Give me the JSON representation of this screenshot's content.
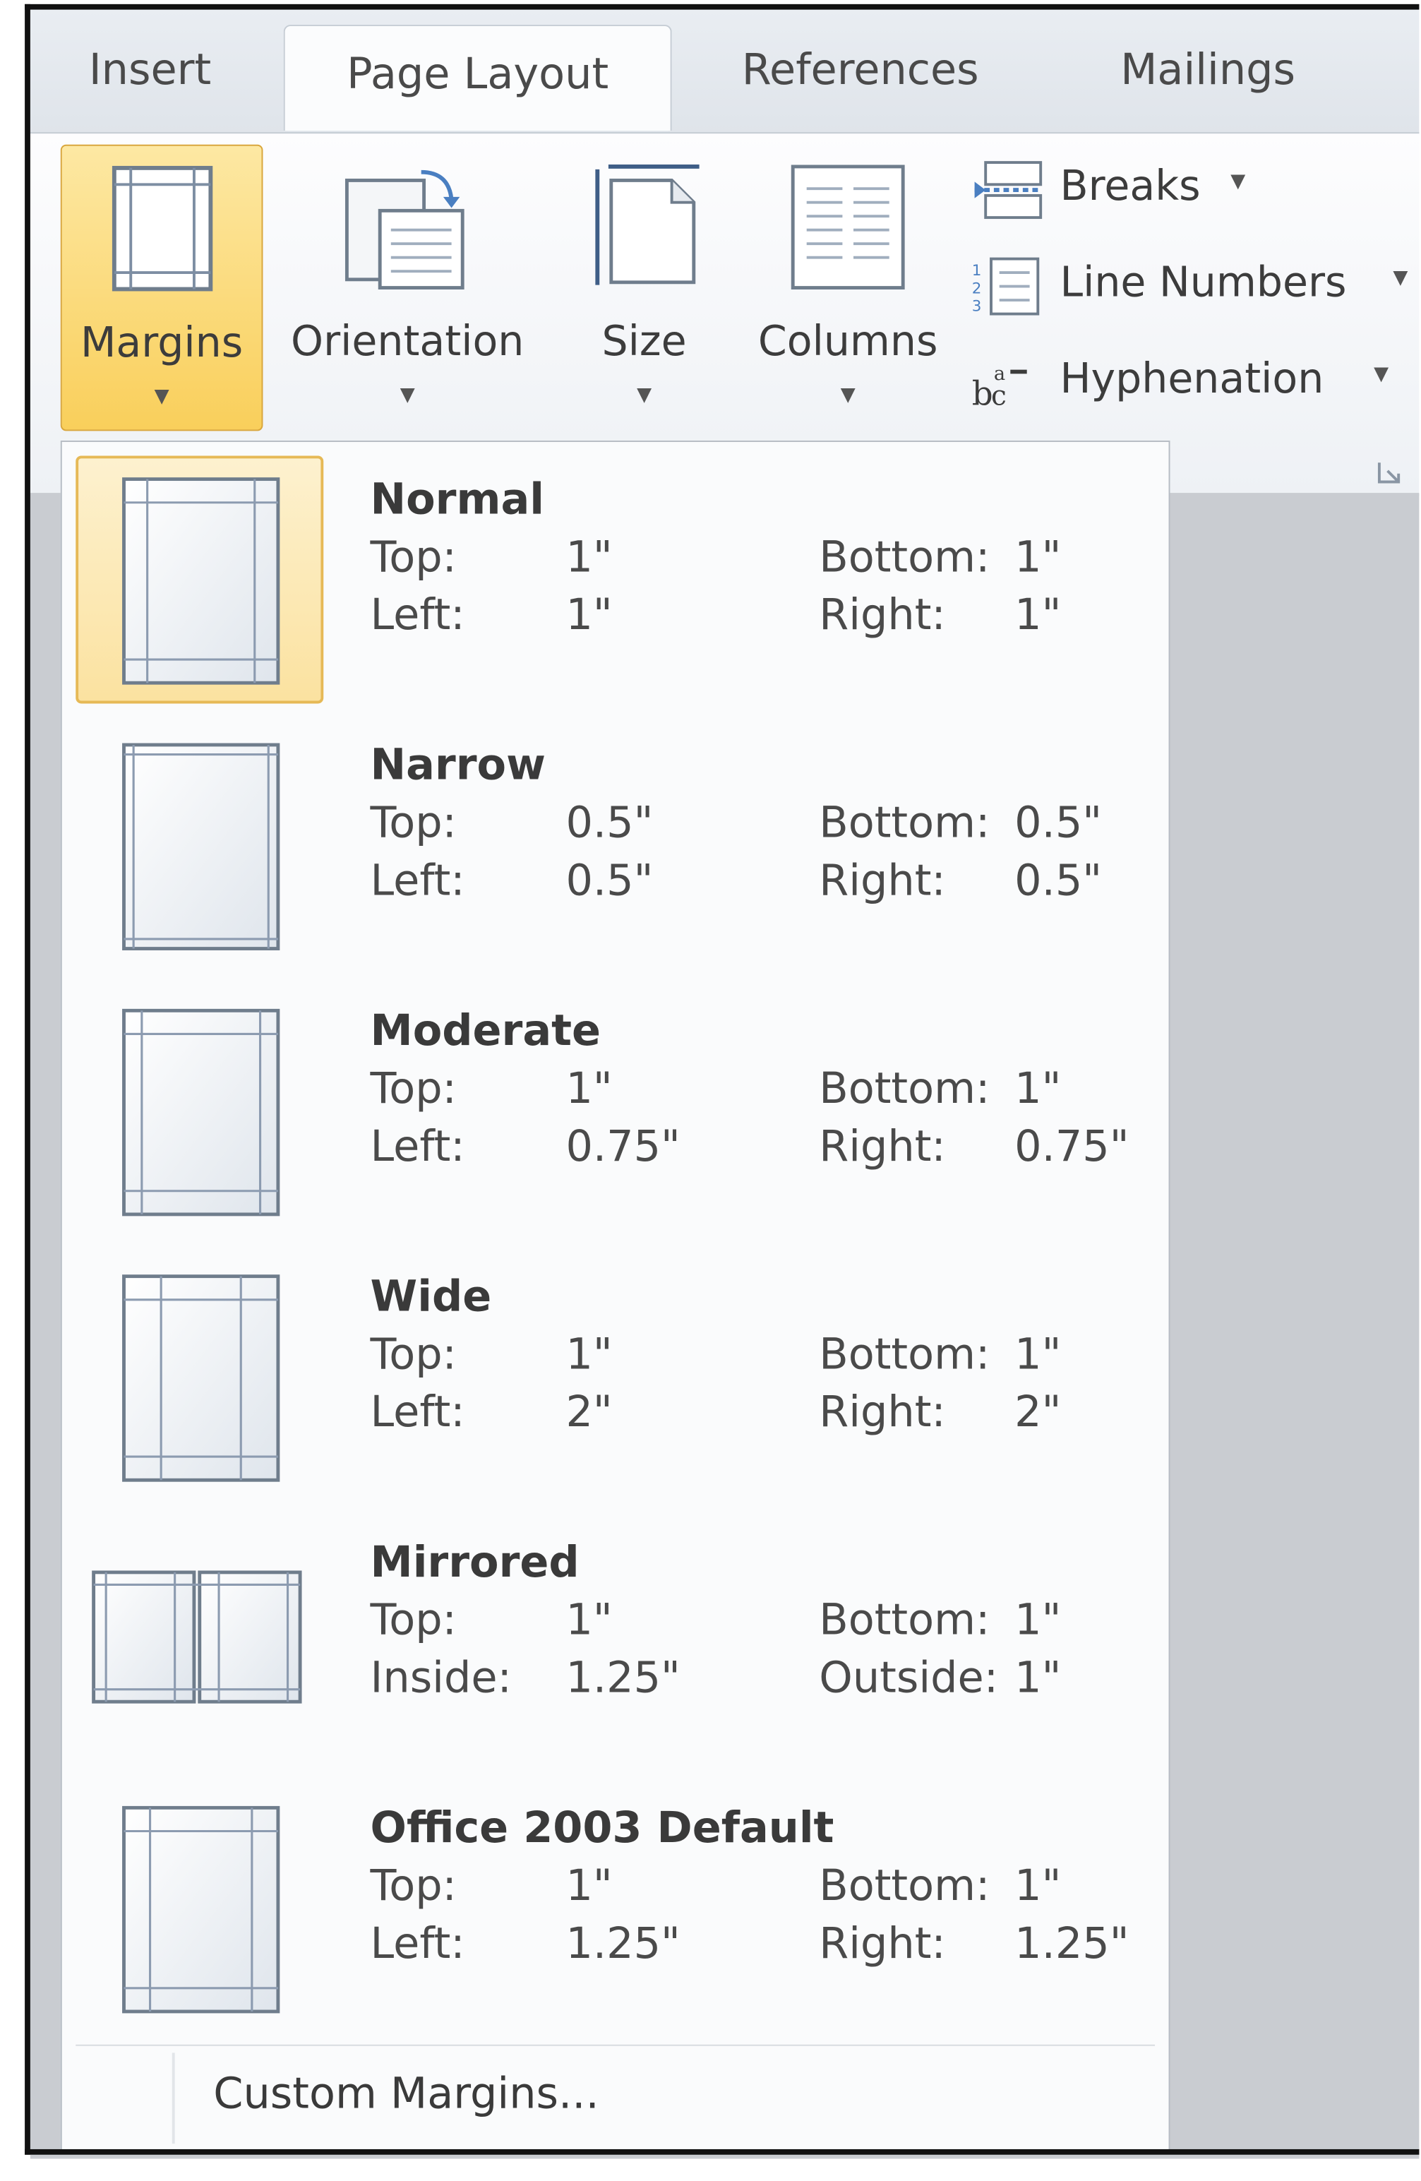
{
  "tabs": [
    {
      "label": "Insert",
      "active": false
    },
    {
      "label": "Page Layout",
      "active": true
    },
    {
      "label": "References",
      "active": false
    },
    {
      "label": "Mailings",
      "active": false
    }
  ],
  "ribbon": {
    "margins_label": "Margins",
    "orientation_label": "Orientation",
    "size_label": "Size",
    "columns_label": "Columns",
    "breaks_label": "Breaks",
    "line_numbers_label": "Line Numbers",
    "hyphenation_label": "Hyphenation",
    "caret": "▼"
  },
  "colors": {
    "selected_bg": "#fbe2a0",
    "selected_border": "#e6b956",
    "button_active": "#f9cf5b"
  },
  "margins_menu": {
    "options": [
      {
        "name": "Normal",
        "selected": true,
        "icon": "margin-normal-icon",
        "rows": [
          {
            "a_label": "Top:",
            "a_value": "1\"",
            "b_label": "Bottom:",
            "b_value": "1\""
          },
          {
            "a_label": "Left:",
            "a_value": "1\"",
            "b_label": "Right:",
            "b_value": "1\""
          }
        ]
      },
      {
        "name": "Narrow",
        "selected": false,
        "icon": "margin-narrow-icon",
        "rows": [
          {
            "a_label": "Top:",
            "a_value": "0.5\"",
            "b_label": "Bottom:",
            "b_value": "0.5\""
          },
          {
            "a_label": "Left:",
            "a_value": "0.5\"",
            "b_label": "Right:",
            "b_value": "0.5\""
          }
        ]
      },
      {
        "name": "Moderate",
        "selected": false,
        "icon": "margin-moderate-icon",
        "rows": [
          {
            "a_label": "Top:",
            "a_value": "1\"",
            "b_label": "Bottom:",
            "b_value": "1\""
          },
          {
            "a_label": "Left:",
            "a_value": "0.75\"",
            "b_label": "Right:",
            "b_value": "0.75\""
          }
        ]
      },
      {
        "name": "Wide",
        "selected": false,
        "icon": "margin-wide-icon",
        "rows": [
          {
            "a_label": "Top:",
            "a_value": "1\"",
            "b_label": "Bottom:",
            "b_value": "1\""
          },
          {
            "a_label": "Left:",
            "a_value": "2\"",
            "b_label": "Right:",
            "b_value": "2\""
          }
        ]
      },
      {
        "name": "Mirrored",
        "selected": false,
        "icon": "margin-mirrored-icon",
        "rows": [
          {
            "a_label": "Top:",
            "a_value": "1\"",
            "b_label": "Bottom:",
            "b_value": "1\""
          },
          {
            "a_label": "Inside:",
            "a_value": "1.25\"",
            "b_label": "Outside:",
            "b_value": "1\""
          }
        ]
      },
      {
        "name": "Office 2003 Default",
        "selected": false,
        "icon": "margin-office2003-icon",
        "rows": [
          {
            "a_label": "Top:",
            "a_value": "1\"",
            "b_label": "Bottom:",
            "b_value": "1\""
          },
          {
            "a_label": "Left:",
            "a_value": "1.25\"",
            "b_label": "Right:",
            "b_value": "1.25\""
          }
        ]
      }
    ],
    "custom_label": "Custom Margins..."
  }
}
